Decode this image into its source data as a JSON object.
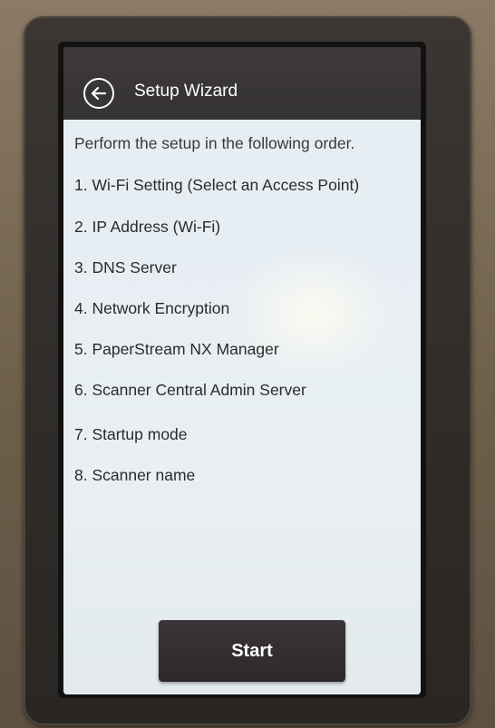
{
  "header": {
    "title": "Setup Wizard",
    "back_icon": "back-arrow-icon"
  },
  "main": {
    "intro": "Perform the setup in the following order.",
    "steps": [
      "1. Wi-Fi Setting (Select an Access Point)",
      "2. IP Address (Wi-Fi)",
      "3. DNS Server",
      "4. Network Encryption",
      "5. PaperStream NX Manager",
      "6. Scanner Central Admin Server",
      "7. Startup mode",
      "8. Scanner name"
    ]
  },
  "footer": {
    "start_label": "Start"
  },
  "colors": {
    "title_bar": "#3a3637",
    "content_bg": "#e6eef3",
    "button_bg": "#312d2e",
    "text": "#2b2b2b"
  }
}
